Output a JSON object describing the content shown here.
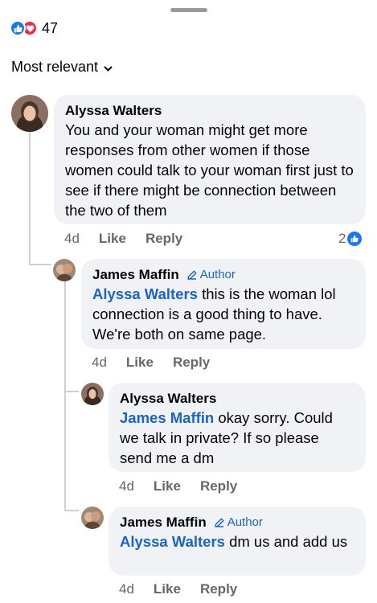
{
  "reactions": {
    "count": "47",
    "like_color": "#1877f2",
    "love_color": "#f0284a"
  },
  "sort": {
    "label": "Most relevant"
  },
  "comments": [
    {
      "author": "Alyssa Walters",
      "text": "You and your woman might get more responses from other women if those women could talk to your woman first just to see if there might be connection between the two of them",
      "time": "4d",
      "like": "Like",
      "reply": "Reply",
      "reaction_count": "2"
    },
    {
      "author": "James Maffin",
      "badge": "Author",
      "mention": "Alyssa Walters",
      "text": " this is the woman lol connection is a good thing to have. We're both on same page.",
      "time": "4d",
      "like": "Like",
      "reply": "Reply"
    },
    {
      "author": "Alyssa Walters",
      "mention": "James Maffin",
      "text": " okay sorry. Could we talk in private? If so please send me a dm",
      "time": "4d",
      "like": "Like",
      "reply": "Reply"
    },
    {
      "author": "James Maffin",
      "badge": "Author",
      "mention": "Alyssa Walters",
      "text": " dm us and add us",
      "time": "4d",
      "like": "Like",
      "reply": "Reply"
    }
  ]
}
